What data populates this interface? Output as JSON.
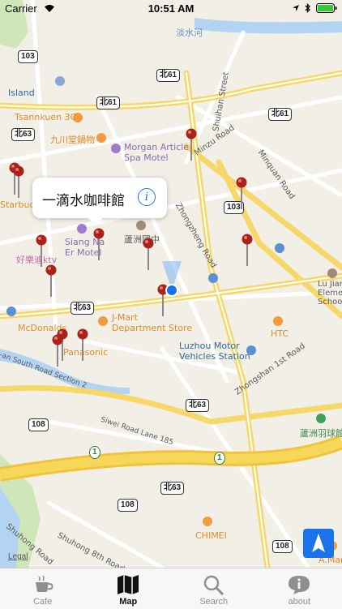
{
  "status_bar": {
    "carrier": "Carrier",
    "time": "10:51 AM"
  },
  "map": {
    "labels": {
      "river_top": "淡水河",
      "island": "Island",
      "tsannkuen": "Tsannkuen 3C",
      "kyushu": "九川堂鍋物",
      "morgan": "Morgan Article\nSpa Motel",
      "starbucks": "Starbuck",
      "siang": "Siang Na\nEr Motel",
      "school": "蘆洲國中",
      "haole": "好樂迪ktv",
      "jmart": "J-Mart\nDepartment Store",
      "mcdonalds": "McDonalds",
      "panasonic": "Panasonic",
      "htc": "HTC",
      "luzhou_station": "Luzhou Motor\nVehicles Station",
      "lujian": "Lu Jian\nElement\nSchool",
      "badminton": "蘆洲羽球館",
      "chimei": "CHIMEI",
      "amart": "A.Mar",
      "shuihan": "Shuihan Street",
      "minzu": "Minzu Road",
      "minquan": "Minquan Road",
      "zhongzheng": "Zhongzheng Road",
      "zhongshan": "Zhongshan 1st Road",
      "siwei": "Siwei Road Lane 185",
      "south_road": "-an South Road Section 2",
      "shuhong8": "Shuhong 8th Road",
      "shuhong_road": "Shuhong Road"
    },
    "shields": {
      "r103a": "103",
      "n61a": "北61",
      "n61b": "北61",
      "n61c": "北61",
      "n63a": "北63",
      "r103b": "103",
      "n63b": "北63",
      "n63c": "北63",
      "r108a": "108",
      "n63d": "北63",
      "r108b": "108",
      "r108c": "108",
      "fwy1a": "1",
      "fwy1b": "1"
    },
    "callout": {
      "title": "一滴水咖啡館",
      "info_icon": "info-icon"
    },
    "legal": "Legal",
    "accent": "#1a73e8"
  },
  "tabbar": {
    "tabs": [
      {
        "label": "Cafe",
        "icon": "coffee-cup-icon"
      },
      {
        "label": "Map",
        "icon": "map-icon"
      },
      {
        "label": "Search",
        "icon": "search-icon"
      },
      {
        "label": "about",
        "icon": "chat-bubble-icon"
      }
    ],
    "selected": "Map"
  }
}
